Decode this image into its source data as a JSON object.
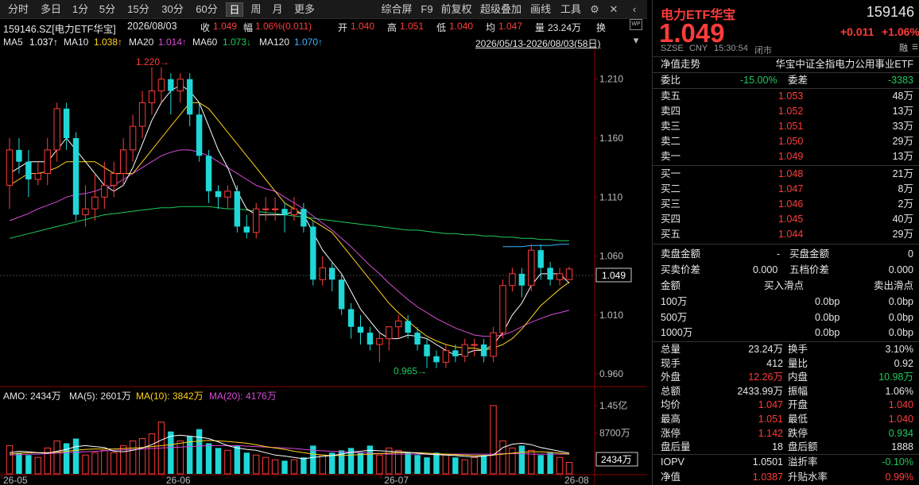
{
  "toolbar": {
    "tabs": [
      "分时",
      "多日",
      "1分",
      "5分",
      "15分",
      "30分",
      "60分",
      "日",
      "周",
      "月",
      "更多"
    ],
    "active": "日",
    "right": [
      "综合屏",
      "F9",
      "前复权",
      "超级叠加",
      "画线",
      "工具"
    ]
  },
  "header": {
    "code_name": "159146.SZ[电力ETF华宝]",
    "date": "2026/08/03",
    "close_label": "收",
    "close": "1.049",
    "range_label": "幅",
    "range": "1.06%(0.011)",
    "open_label": "开",
    "open": "1.040",
    "high_label": "高",
    "high": "1.051",
    "low_label": "低",
    "low": "1.040",
    "avg_label": "均",
    "avg": "1.047",
    "vol_label": "量",
    "vol": "23.24万",
    "huan": "换",
    "period": "2026/05/13-2026/08/03(58日)"
  },
  "ma": {
    "ma5_label": "MA5",
    "ma5": "1.037↑",
    "ma10_label": "MA10",
    "ma10": "1.038↑",
    "ma20_label": "MA20",
    "ma20": "1.014↑",
    "ma60_label": "MA60",
    "ma60": "1.073↓",
    "ma120_label": "MA120",
    "ma120": "1.070↑"
  },
  "annot": {
    "high": "1.220",
    "low": "0.965"
  },
  "axis": {
    "y": [
      "1.210",
      "1.160",
      "1.110",
      "1.060",
      "1.010",
      "0.960"
    ],
    "current": "1.049",
    "vol_y": [
      "1.45亿",
      "8700万"
    ],
    "vol_current": "2434万",
    "x": [
      "26-05",
      "26-06",
      "26-07",
      "26-08"
    ]
  },
  "amo": {
    "label": "AMO: 2434万",
    "ma5": "MA(5): 2601万",
    "ma10": "MA(10): 3842万",
    "ma20": "MA(20): 4176万"
  },
  "colors": {
    "up": "#ff3b3b",
    "down": "#1fd7d7",
    "ma5": "#ffffff",
    "ma10": "#ffd21c",
    "ma20": "#d94cd9",
    "ma60": "#1fc95d",
    "ma120": "#3ab4ff"
  },
  "chart_data": {
    "type": "candlestick",
    "ylim": [
      0.95,
      1.23
    ],
    "candles": [
      [
        1.12,
        1.15,
        1.16,
        1.1
      ],
      [
        1.15,
        1.14,
        1.16,
        1.13
      ],
      [
        1.14,
        1.125,
        1.15,
        1.11
      ],
      [
        1.125,
        1.13,
        1.14,
        1.12
      ],
      [
        1.13,
        1.15,
        1.16,
        1.12
      ],
      [
        1.15,
        1.185,
        1.19,
        1.14
      ],
      [
        1.185,
        1.16,
        1.19,
        1.15
      ],
      [
        1.16,
        1.095,
        1.165,
        1.09
      ],
      [
        1.095,
        1.1,
        1.12,
        1.085
      ],
      [
        1.1,
        1.11,
        1.13,
        1.09
      ],
      [
        1.11,
        1.12,
        1.14,
        1.1
      ],
      [
        1.12,
        1.13,
        1.14,
        1.11
      ],
      [
        1.13,
        1.15,
        1.16,
        1.12
      ],
      [
        1.15,
        1.17,
        1.18,
        1.14
      ],
      [
        1.17,
        1.19,
        1.2,
        1.16
      ],
      [
        1.19,
        1.2,
        1.22,
        1.18
      ],
      [
        1.2,
        1.21,
        1.22,
        1.19
      ],
      [
        1.21,
        1.2,
        1.215,
        1.18
      ],
      [
        1.2,
        1.21,
        1.215,
        1.19
      ],
      [
        1.21,
        1.18,
        1.215,
        1.17
      ],
      [
        1.18,
        1.145,
        1.19,
        1.14
      ],
      [
        1.145,
        1.115,
        1.15,
        1.105
      ],
      [
        1.115,
        1.11,
        1.12,
        1.1
      ],
      [
        1.11,
        1.115,
        1.12,
        1.1
      ],
      [
        1.115,
        1.085,
        1.12,
        1.08
      ],
      [
        1.085,
        1.08,
        1.095,
        1.075
      ],
      [
        1.08,
        1.1,
        1.105,
        1.075
      ],
      [
        1.1,
        1.1,
        1.11,
        1.09
      ],
      [
        1.1,
        1.1,
        1.11,
        1.09
      ],
      [
        1.1,
        1.095,
        1.105,
        1.08
      ],
      [
        1.095,
        1.1,
        1.11,
        1.09
      ],
      [
        1.1,
        1.085,
        1.105,
        1.08
      ],
      [
        1.085,
        1.04,
        1.09,
        1.035
      ],
      [
        1.04,
        1.05,
        1.06,
        1.035
      ],
      [
        1.05,
        1.04,
        1.055,
        1.03
      ],
      [
        1.04,
        1.015,
        1.045,
        1.01
      ],
      [
        1.015,
        1.0,
        1.02,
        0.99
      ],
      [
        1.0,
        0.995,
        1.01,
        0.985
      ],
      [
        0.995,
        0.985,
        1.0,
        0.98
      ],
      [
        0.985,
        0.99,
        0.995,
        0.97
      ],
      [
        0.99,
        1.0,
        1.0,
        0.98
      ],
      [
        1.0,
        1.005,
        1.01,
        0.99
      ],
      [
        1.005,
        0.995,
        1.01,
        0.99
      ],
      [
        0.995,
        0.985,
        1.0,
        0.98
      ],
      [
        0.985,
        0.975,
        0.99,
        0.965
      ],
      [
        0.975,
        0.97,
        0.98,
        0.965
      ],
      [
        0.97,
        0.98,
        0.985,
        0.965
      ],
      [
        0.98,
        0.975,
        0.985,
        0.97
      ],
      [
        0.975,
        0.985,
        0.99,
        0.97
      ],
      [
        0.985,
        0.985,
        0.99,
        0.975
      ],
      [
        0.985,
        0.975,
        0.99,
        0.97
      ],
      [
        0.975,
        0.995,
        1.0,
        0.97
      ],
      [
        0.995,
        1.035,
        1.04,
        0.99
      ],
      [
        1.035,
        1.045,
        1.05,
        1.03
      ],
      [
        1.045,
        1.035,
        1.05,
        1.025
      ],
      [
        1.035,
        1.065,
        1.07,
        1.03
      ],
      [
        1.065,
        1.05,
        1.07,
        1.04
      ],
      [
        1.05,
        1.04,
        1.055,
        1.035
      ],
      [
        1.04,
        1.045,
        1.05,
        1.035
      ],
      [
        1.04,
        1.049,
        1.051,
        1.04
      ]
    ],
    "ma5": [
      1.13,
      1.135,
      1.14,
      1.14,
      1.14,
      1.15,
      1.16,
      1.15,
      1.14,
      1.13,
      1.12,
      1.115,
      1.12,
      1.135,
      1.155,
      1.175,
      1.19,
      1.2,
      1.205,
      1.2,
      1.19,
      1.17,
      1.15,
      1.135,
      1.115,
      1.1,
      1.095,
      1.095,
      1.095,
      1.095,
      1.098,
      1.095,
      1.08,
      1.065,
      1.055,
      1.045,
      1.03,
      1.015,
      1.005,
      0.995,
      0.99,
      0.99,
      0.993,
      0.992,
      0.99,
      0.985,
      0.98,
      0.976,
      0.977,
      0.98,
      0.98,
      0.985,
      0.995,
      1.01,
      1.02,
      1.035,
      1.045,
      1.045,
      1.045,
      1.037
    ],
    "ma10": [
      1.12,
      1.125,
      1.13,
      1.13,
      1.132,
      1.135,
      1.14,
      1.14,
      1.14,
      1.14,
      1.135,
      1.13,
      1.13,
      1.13,
      1.14,
      1.15,
      1.16,
      1.17,
      1.18,
      1.19,
      1.19,
      1.185,
      1.175,
      1.165,
      1.155,
      1.145,
      1.135,
      1.125,
      1.115,
      1.105,
      1.1,
      1.095,
      1.09,
      1.085,
      1.08,
      1.07,
      1.06,
      1.05,
      1.04,
      1.03,
      1.02,
      1.012,
      1.005,
      0.998,
      0.992,
      0.988,
      0.985,
      0.983,
      0.982,
      0.982,
      0.98,
      0.982,
      0.985,
      0.99,
      0.998,
      1.008,
      1.018,
      1.025,
      1.032,
      1.038
    ],
    "ma20": [
      1.09,
      1.093,
      1.096,
      1.1,
      1.103,
      1.106,
      1.11,
      1.112,
      1.113,
      1.115,
      1.118,
      1.12,
      1.125,
      1.13,
      1.135,
      1.14,
      1.145,
      1.148,
      1.15,
      1.15,
      1.148,
      1.145,
      1.14,
      1.135,
      1.13,
      1.125,
      1.12,
      1.117,
      1.115,
      1.11,
      1.105,
      1.1,
      1.094,
      1.088,
      1.082,
      1.075,
      1.068,
      1.06,
      1.052,
      1.045,
      1.037,
      1.03,
      1.023,
      1.017,
      1.012,
      1.007,
      1.003,
      0.999,
      0.996,
      0.993,
      0.992,
      0.992,
      0.993,
      0.996,
      1.0,
      1.004,
      1.007,
      1.01,
      1.012,
      1.014
    ],
    "ma60": [
      1.075,
      1.077,
      1.079,
      1.081,
      1.083,
      1.085,
      1.087,
      1.089,
      1.091,
      1.093,
      1.095,
      1.096,
      1.097,
      1.098,
      1.099,
      1.1,
      1.101,
      1.101,
      1.102,
      1.102,
      1.102,
      1.102,
      1.101,
      1.1,
      1.1,
      1.099,
      1.098,
      1.097,
      1.096,
      1.095,
      1.094,
      1.093,
      1.092,
      1.091,
      1.09,
      1.089,
      1.088,
      1.087,
      1.086,
      1.085,
      1.084,
      1.083,
      1.082,
      1.082,
      1.081,
      1.08,
      1.079,
      1.079,
      1.078,
      1.078,
      1.077,
      1.077,
      1.076,
      1.076,
      1.075,
      1.075,
      1.074,
      1.074,
      1.073,
      1.073
    ],
    "ma120": {
      "start_index": 52,
      "values": [
        1.068,
        1.068,
        1.068,
        1.069,
        1.069,
        1.069,
        1.07,
        1.07
      ]
    },
    "volume": [
      60,
      45,
      40,
      35,
      55,
      70,
      65,
      75,
      40,
      45,
      50,
      45,
      60,
      70,
      75,
      85,
      110,
      90,
      70,
      80,
      95,
      65,
      55,
      50,
      60,
      45,
      40,
      35,
      30,
      28,
      30,
      35,
      60,
      40,
      45,
      50,
      55,
      45,
      60,
      40,
      55,
      50,
      45,
      40,
      35,
      45,
      40,
      35,
      30,
      35,
      40,
      145,
      70,
      55,
      60,
      50,
      40,
      45,
      35,
      24.34
    ],
    "vol_ma5": [
      45,
      48,
      47,
      45,
      44,
      48,
      52,
      58,
      60,
      58,
      56,
      48,
      47,
      50,
      55,
      62,
      72,
      80,
      82,
      80,
      78,
      75,
      68,
      60,
      55,
      52,
      50,
      45,
      40,
      38,
      35,
      32,
      35,
      37,
      39,
      42,
      46,
      48,
      50,
      49,
      48,
      47,
      46,
      44,
      42,
      41,
      40,
      39,
      37,
      36,
      38,
      40,
      56,
      63,
      65,
      62,
      56,
      52,
      48,
      44
    ],
    "vol_ma10": [
      42,
      44,
      45,
      45,
      45,
      46,
      48,
      50,
      52,
      53,
      53,
      53,
      54,
      55,
      56,
      58,
      60,
      62,
      65,
      68,
      70,
      71,
      70,
      69,
      67,
      65,
      62,
      58,
      55,
      52,
      48,
      45,
      42,
      40,
      39,
      39,
      40,
      41,
      42,
      43,
      44,
      45,
      45,
      45,
      44,
      43,
      42,
      41,
      40,
      39,
      39,
      40,
      42,
      44,
      46,
      47,
      47,
      46,
      44,
      42
    ],
    "vol_ma20": [
      40,
      41,
      42,
      42,
      43,
      44,
      45,
      46,
      47,
      48,
      49,
      50,
      51,
      52,
      53,
      54,
      55,
      56,
      57,
      58,
      59,
      60,
      60,
      60,
      60,
      59,
      58,
      57,
      56,
      55,
      54,
      52,
      50,
      49,
      48,
      47,
      46,
      45,
      44,
      43,
      42,
      42,
      42,
      42,
      42,
      42,
      42,
      42,
      42,
      42,
      42,
      42,
      43,
      43,
      43,
      42,
      42,
      42,
      42,
      42
    ]
  },
  "right": {
    "name": "电力ETF华宝",
    "code": "159146",
    "price": "1.049",
    "change": "+0.011",
    "pct": "+1.06%",
    "meta": {
      "market": "SZSE",
      "cur": "CNY",
      "time": "15:30:54",
      "status": "闭市"
    },
    "nav_trend": "净值走势",
    "fund_name": "华宝中证全指电力公用事业ETF",
    "weibi_label": "委比",
    "weibi": "-15.00%",
    "weicha_label": "委差",
    "weicha": "-3383",
    "sells": [
      {
        "label": "卖五",
        "price": "1.053",
        "vol": "48万"
      },
      {
        "label": "卖四",
        "price": "1.052",
        "vol": "13万"
      },
      {
        "label": "卖三",
        "price": "1.051",
        "vol": "33万"
      },
      {
        "label": "卖二",
        "price": "1.050",
        "vol": "29万"
      },
      {
        "label": "卖一",
        "price": "1.049",
        "vol": "13万"
      }
    ],
    "buys": [
      {
        "label": "买一",
        "price": "1.048",
        "vol": "21万"
      },
      {
        "label": "买二",
        "price": "1.047",
        "vol": "8万"
      },
      {
        "label": "买三",
        "price": "1.046",
        "vol": "2万"
      },
      {
        "label": "买四",
        "price": "1.045",
        "vol": "40万"
      },
      {
        "label": "买五",
        "price": "1.044",
        "vol": "29万"
      }
    ],
    "slip": {
      "r1a": "卖盘金额",
      "r1b": "-",
      "r1c": "买盘金额",
      "r1d": "0",
      "r2a": "买卖价差",
      "r2b": "0.000",
      "r2c": "五档价差",
      "r2d": "0.000",
      "h1": "金额",
      "h2": "买入滑点",
      "h3": "卖出滑点",
      "rows": [
        {
          "a": "100万",
          "b": "0.0bp",
          "c": "0.0bp"
        },
        {
          "a": "500万",
          "b": "0.0bp",
          "c": "0.0bp"
        },
        {
          "a": "1000万",
          "b": "0.0bp",
          "c": "0.0bp"
        }
      ]
    },
    "stats": [
      {
        "l1": "总量",
        "v1": "23.24万",
        "l2": "换手",
        "v2": "3.10%",
        "c1": "w",
        "c2": "w"
      },
      {
        "l1": "现手",
        "v1": "412",
        "l2": "量比",
        "v2": "0.92",
        "c1": "w",
        "c2": "w"
      },
      {
        "l1": "外盘",
        "v1": "12.26万",
        "l2": "内盘",
        "v2": "10.98万",
        "c1": "r",
        "c2": "g"
      },
      {
        "l1": "总额",
        "v1": "2433.99万",
        "l2": "振幅",
        "v2": "1.06%",
        "c1": "w",
        "c2": "w"
      },
      {
        "l1": "均价",
        "v1": "1.047",
        "l2": "开盘",
        "v2": "1.040",
        "c1": "r",
        "c2": "r"
      },
      {
        "l1": "最高",
        "v1": "1.051",
        "l2": "最低",
        "v2": "1.040",
        "c1": "r",
        "c2": "r"
      },
      {
        "l1": "涨停",
        "v1": "1.142",
        "l2": "跌停",
        "v2": "0.934",
        "c1": "r",
        "c2": "g"
      },
      {
        "l1": "盘后量",
        "v1": "18",
        "l2": "盘后额",
        "v2": "1888",
        "c1": "w",
        "c2": "w"
      }
    ],
    "iopv": [
      {
        "l1": "IOPV",
        "v1": "1.0501",
        "l2": "溢折率",
        "v2": "-0.10%",
        "c1": "w",
        "c2": "g"
      },
      {
        "l1": "净值",
        "v1": "1.0387",
        "l2": "升贴水率",
        "v2": "0.99%",
        "c1": "r",
        "c2": "r"
      }
    ],
    "rong": "融"
  }
}
